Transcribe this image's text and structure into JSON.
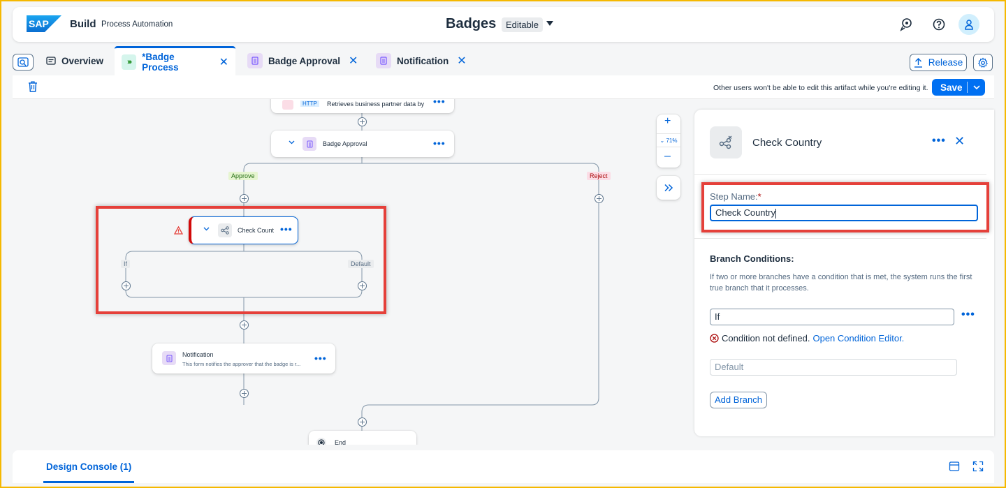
{
  "shell": {
    "logo": "SAP",
    "brand": "Build",
    "product": "Process Automation",
    "title": "Badges",
    "status": "Editable"
  },
  "tabs": [
    {
      "label": "Overview"
    },
    {
      "label": "*Badge Process",
      "active": true
    },
    {
      "label": "Badge Approval"
    },
    {
      "label": "Notification"
    }
  ],
  "tabbar": {
    "release_label": "Release"
  },
  "toolbar": {
    "note": "Other users won't be able to edit this artifact while you're editing it.",
    "save_label": "Save"
  },
  "canvas": {
    "zoom": "71%",
    "nodes": {
      "partner": "Retrieves business partner data by",
      "partner_tag": "HTTP",
      "approval": "Badge Approval",
      "check": "Check Count",
      "notification_title": "Notification",
      "notification_desc": "This form notifies the approver that the badge is r...",
      "end": "End"
    },
    "branches": {
      "approve": "Approve",
      "reject": "Reject",
      "if": "If",
      "default": "Default"
    }
  },
  "panel": {
    "title": "Check Country",
    "step_name_label": "Step Name:",
    "required_mark": "*",
    "step_name_value": "Check Country",
    "branch_conditions_title": "Branch Conditions:",
    "help": "If two or more branches have a condition that is met, the system runs the first true branch that it processes.",
    "if_value": "If",
    "error_text": "Condition not defined.",
    "error_link": "Open Condition Editor.",
    "default_placeholder": "Default",
    "add_branch_label": "Add Branch"
  },
  "console": {
    "tab_label": "Design Console (1)"
  },
  "colors": {
    "accent": "#0064d9",
    "highlight": "#e5403a",
    "approve_tag": "#e6f5d0",
    "reject_tag": "#fbdde6",
    "error": "#aa0808"
  }
}
